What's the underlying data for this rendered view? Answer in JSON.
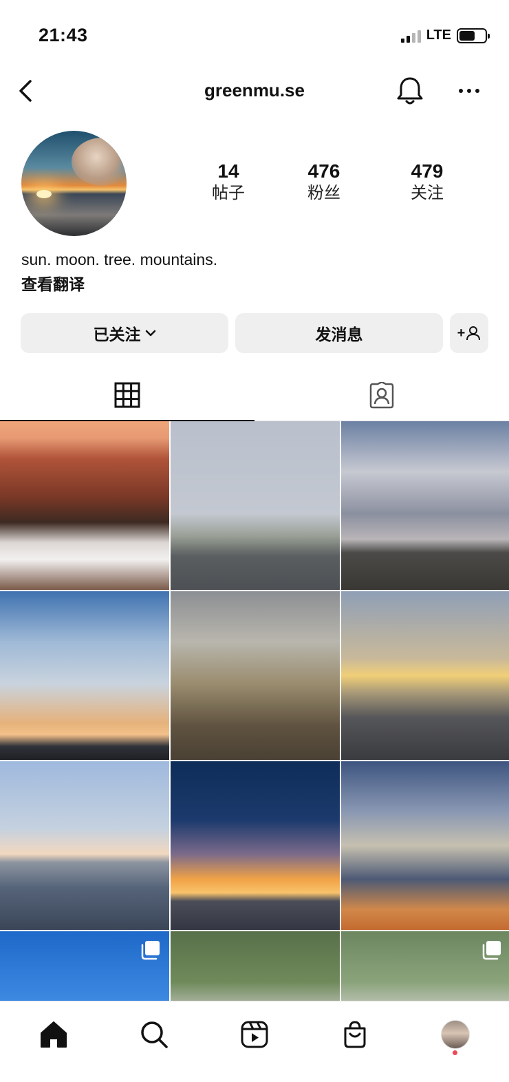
{
  "status_bar": {
    "time": "21:43",
    "network": "LTE",
    "battery_level": 0.6
  },
  "header": {
    "username": "greenmu.se",
    "icons": [
      "back-icon",
      "bell-icon",
      "more-icon"
    ]
  },
  "profile": {
    "stats": [
      {
        "number": "14",
        "label": "帖子"
      },
      {
        "number": "476",
        "label": "粉丝"
      },
      {
        "number": "479",
        "label": "关注"
      }
    ],
    "bio": "sun. moon. tree. mountains.",
    "translate_link": "查看翻译"
  },
  "actions": {
    "following_label": "已关注",
    "message_label": "发消息",
    "add_user_label": "+"
  },
  "tabs": [
    {
      "icon": "grid-icon",
      "selected": true
    },
    {
      "icon": "tagged-icon",
      "selected": false
    }
  ],
  "grid": {
    "post_count_visible": 12,
    "multi_photo_posts": [
      9,
      11
    ]
  },
  "bottom_nav": [
    {
      "icon": "home-icon",
      "selected": true
    },
    {
      "icon": "search-icon",
      "selected": false
    },
    {
      "icon": "reels-icon",
      "selected": false
    },
    {
      "icon": "shop-icon",
      "selected": false
    },
    {
      "icon": "profile-avatar",
      "selected": false
    }
  ],
  "colors": {
    "notification_dot": "#ed4956",
    "button_bg": "#efefef"
  }
}
